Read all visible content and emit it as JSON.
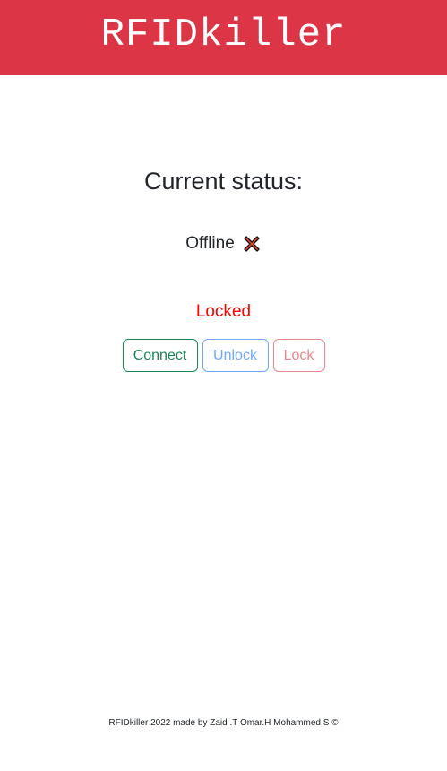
{
  "header": {
    "title": "RFIDkiller",
    "background_color": "#dc3545"
  },
  "status": {
    "heading": "Current status:",
    "connection_label": "Offline",
    "connection_icon": "cross-mark-icon",
    "lock_state": "Locked",
    "lock_state_color": "#ff0000"
  },
  "buttons": {
    "connect_label": "Connect",
    "unlock_label": "Unlock",
    "lock_label": "Lock"
  },
  "footer": {
    "text": "RFIDkiller 2022 made by Zaid .T Omar.H Mohammed.S ©"
  }
}
